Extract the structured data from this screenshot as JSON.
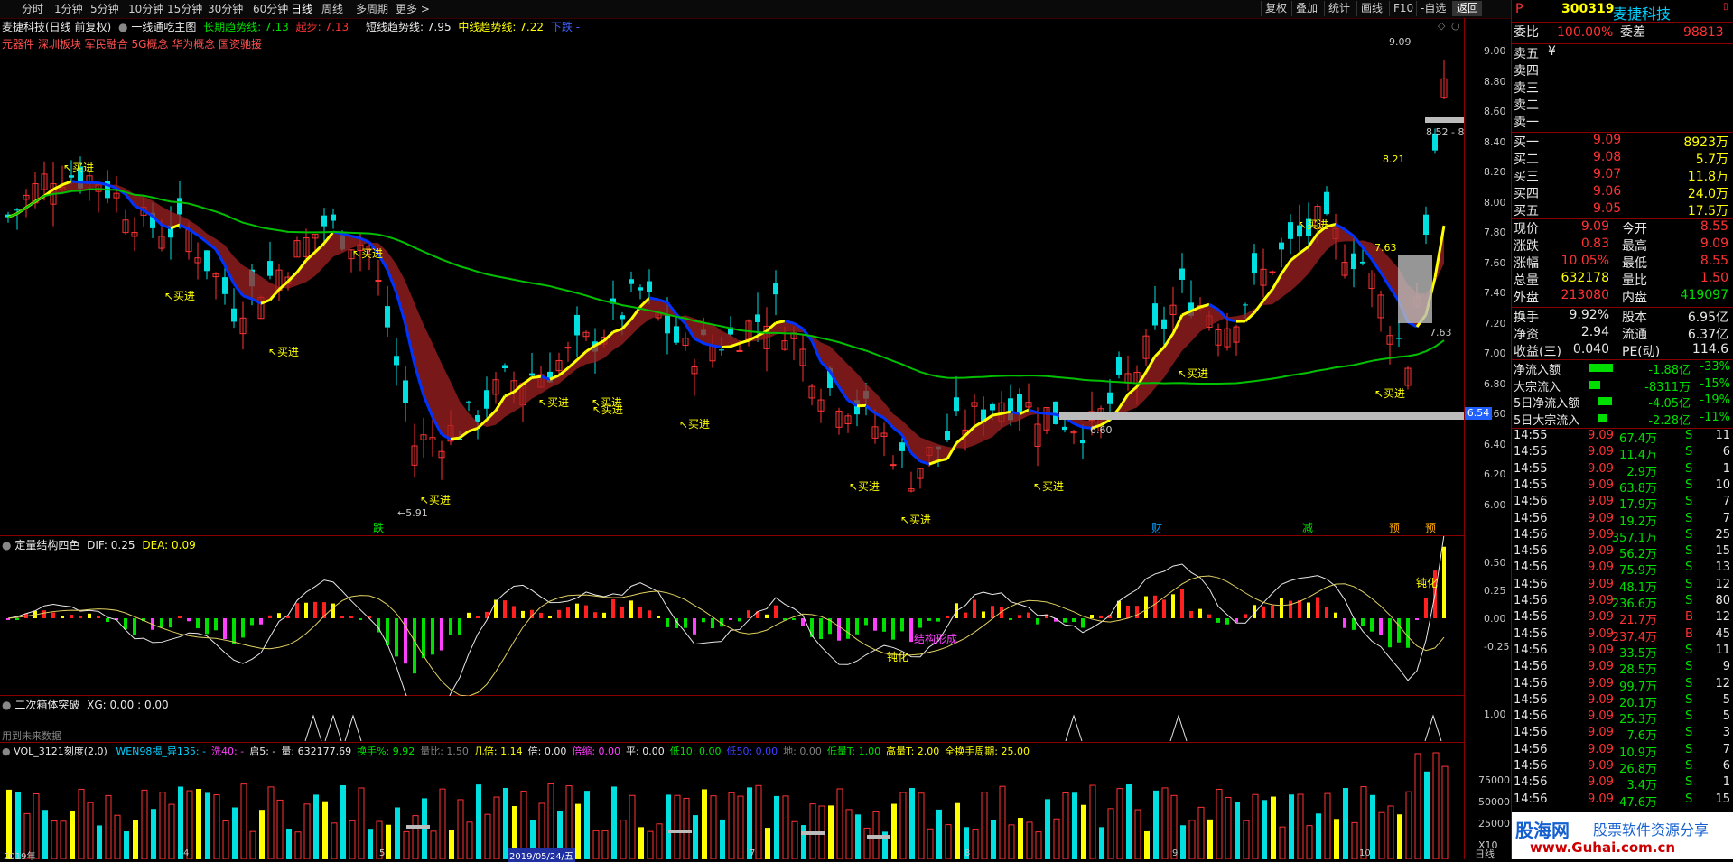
{
  "toolbar": {
    "left_items": [
      "分时",
      "1分钟",
      "5分钟",
      "10分钟",
      "15分钟",
      "30分钟",
      "60分钟",
      "日线",
      "周线",
      "多周期",
      "更多 >"
    ],
    "right_items": [
      "复权",
      "叠加",
      "统计",
      "画线",
      "F10",
      "-自选",
      "返回"
    ],
    "active": "日线"
  },
  "header": {
    "stock_name": "麦捷科技(日线 前复权)",
    "indicator": "一线通吃主图",
    "long_trend_label": "长期趋势线:",
    "long_trend_value": "7.13",
    "start_label": "起步:",
    "start_value": "7.13",
    "short_trend_label": "短线趋势线:",
    "short_trend_value": "7.95",
    "mid_trend_label": "中线趋势线:",
    "mid_trend_value": "7.22",
    "state": "下跌",
    "state_suffix": "-",
    "concepts": "元器件 深圳板块 军民融合 5G概念 华为概念 国资驰援"
  },
  "main_axis": [
    "9.00",
    "8.80",
    "8.60",
    "8.40",
    "8.20",
    "8.00",
    "7.80",
    "7.60",
    "7.40",
    "7.20",
    "7.00",
    "6.80",
    "6.60",
    "6.40",
    "6.20",
    "6.00"
  ],
  "price_annotations": {
    "high": "9.09",
    "range": "8.52 - 8.",
    "p821": "8.21",
    "p763a": "7.63",
    "p763b": "7.63",
    "p660": "6.60",
    "low": "5.91",
    "current_tag": "6.54"
  },
  "signals": {
    "buy": "买进",
    "buy_list": [
      "买进",
      "买进",
      "买进",
      "买进",
      "买进",
      "买进",
      "买进",
      "买进",
      "买进",
      "买进",
      "买进",
      "买进",
      "买进",
      "买进",
      "买进"
    ],
    "bottom_tags": [
      {
        "text": "跌",
        "color": "#00e000"
      },
      {
        "text": "财",
        "color": "#00a0ff"
      },
      {
        "text": "减",
        "color": "#00e000"
      },
      {
        "text": "预",
        "color": "#ffaa00"
      },
      {
        "text": "预",
        "color": "#ffaa00"
      }
    ]
  },
  "macd_pane": {
    "title": "定量结构四色",
    "dif_label": "DIF:",
    "dif": "0.25",
    "dea_label": "DEA:",
    "dea": "0.09",
    "axis": [
      "0.50",
      "0.25",
      "0.00",
      "-0.25"
    ],
    "notes": [
      "钝化",
      "结构形成",
      "钝化"
    ]
  },
  "box_pane": {
    "title": "二次箱体突破",
    "xg_label": "XG:",
    "xg": "0.00",
    "xg2": ": 0.00",
    "axis": [
      "1.00"
    ],
    "footer": "用到未来数据"
  },
  "vol_pane": {
    "title": "VOL_3121刻度(2,0)",
    "items": [
      {
        "t": "WEN98揭_异135: -",
        "c": "#00d0ff"
      },
      {
        "t": "洗40: -",
        "c": "#ff40ff"
      },
      {
        "t": "启5: -",
        "c": "#e8e8e8"
      },
      {
        "t": "量: 632177.69",
        "c": "#e8e8e8"
      },
      {
        "t": "换手%: 9.92",
        "c": "#00e000"
      },
      {
        "t": "量比: 1.50",
        "c": "#808080"
      },
      {
        "t": "几倍: 1.14",
        "c": "#ffff00"
      },
      {
        "t": "倍: 0.00",
        "c": "#e8e8e8"
      },
      {
        "t": "倍缩: 0.00",
        "c": "#ff40ff"
      },
      {
        "t": "平: 0.00",
        "c": "#e8e8e8"
      },
      {
        "t": "低10: 0.00",
        "c": "#00e000"
      },
      {
        "t": "低50: 0.00",
        "c": "#4040ff"
      },
      {
        "t": "地: 0.00",
        "c": "#808080"
      },
      {
        "t": "低量T: 1.00",
        "c": "#00e000"
      },
      {
        "t": "高量T: 2.00",
        "c": "#ffff00"
      },
      {
        "t": "全换手周期: 25.00",
        "c": "#ffff00"
      }
    ],
    "axis": [
      "75000",
      "50000",
      "25000",
      "X10"
    ],
    "dates": [
      "2019年",
      "4",
      "5",
      "2019/05/24/五",
      "7",
      "8",
      "9",
      "10"
    ],
    "period_tab": "日线"
  },
  "quote": {
    "code": "300319",
    "name": "麦捷科技",
    "weibi_label": "委比",
    "weibi": "100.00%",
    "weicha_label": "委差",
    "weicha": "98813",
    "asks": [
      {
        "label": "卖五",
        "price": "¥",
        "vol": ""
      },
      {
        "label": "卖四",
        "price": "",
        "vol": ""
      },
      {
        "label": "卖三",
        "price": "",
        "vol": ""
      },
      {
        "label": "卖二",
        "price": "",
        "vol": ""
      },
      {
        "label": "卖一",
        "price": "",
        "vol": ""
      }
    ],
    "bids": [
      {
        "label": "买一",
        "price": "9.09",
        "vol": "8923万"
      },
      {
        "label": "买二",
        "price": "9.08",
        "vol": "5.7万"
      },
      {
        "label": "买三",
        "price": "9.07",
        "vol": "11.8万"
      },
      {
        "label": "买四",
        "price": "9.06",
        "vol": "24.0万"
      },
      {
        "label": "买五",
        "price": "9.05",
        "vol": "17.5万"
      }
    ],
    "stats": [
      {
        "l1": "现价",
        "v1": "9.09",
        "l2": "今开",
        "v2": "8.55"
      },
      {
        "l1": "涨跌",
        "v1": "0.83",
        "l2": "最高",
        "v2": "9.09"
      },
      {
        "l1": "涨幅",
        "v1": "10.05%",
        "l2": "最低",
        "v2": "8.55"
      },
      {
        "l1": "总量",
        "v1": "632178",
        "l2": "量比",
        "v2": "1.50"
      },
      {
        "l1": "外盘",
        "v1": "213080",
        "l2": "内盘",
        "v2": "419097"
      }
    ],
    "stats2": [
      {
        "l1": "换手",
        "v1": "9.92%",
        "l2": "股本",
        "v2": "6.95亿"
      },
      {
        "l1": "净资",
        "v1": "2.94",
        "l2": "流通",
        "v2": "6.37亿"
      },
      {
        "l1": "收益(三)",
        "v1": "0.040",
        "l2": "PE(动)",
        "v2": "114.6"
      }
    ],
    "flows": [
      {
        "label": "净流入额",
        "value": "-1.88亿",
        "pct": "-33%",
        "bar": 0.33
      },
      {
        "label": "大宗流入",
        "value": "-8311万",
        "pct": "-15%",
        "bar": 0.15
      },
      {
        "label": "5日净流入额",
        "value": "-4.05亿",
        "pct": "-19%",
        "bar": 0.19
      },
      {
        "label": "5日大宗流入",
        "value": "-2.28亿",
        "pct": "-11%",
        "bar": 0.11
      }
    ],
    "ticks": [
      {
        "t": "14:55",
        "p": "9.09",
        "v": "67.4万",
        "s": "S",
        "n": "11"
      },
      {
        "t": "14:55",
        "p": "9.09",
        "v": "11.4万",
        "s": "S",
        "n": "6"
      },
      {
        "t": "14:55",
        "p": "9.09",
        "v": "2.9万",
        "s": "S",
        "n": "1"
      },
      {
        "t": "14:55",
        "p": "9.09",
        "v": "63.8万",
        "s": "S",
        "n": "10"
      },
      {
        "t": "14:56",
        "p": "9.09",
        "v": "17.9万",
        "s": "S",
        "n": "7"
      },
      {
        "t": "14:56",
        "p": "9.09",
        "v": "19.2万",
        "s": "S",
        "n": "7"
      },
      {
        "t": "14:56",
        "p": "9.09",
        "v": "357.1万",
        "s": "S",
        "n": "25"
      },
      {
        "t": "14:56",
        "p": "9.09",
        "v": "56.2万",
        "s": "S",
        "n": "15"
      },
      {
        "t": "14:56",
        "p": "9.09",
        "v": "75.9万",
        "s": "S",
        "n": "13"
      },
      {
        "t": "14:56",
        "p": "9.09",
        "v": "48.1万",
        "s": "S",
        "n": "12"
      },
      {
        "t": "14:56",
        "p": "9.09",
        "v": "236.6万",
        "s": "S",
        "n": "80"
      },
      {
        "t": "14:56",
        "p": "9.09",
        "v": "21.7万",
        "s": "B",
        "n": "12"
      },
      {
        "t": "14:56",
        "p": "9.09",
        "v": "237.4万",
        "s": "B",
        "n": "45"
      },
      {
        "t": "14:56",
        "p": "9.09",
        "v": "33.5万",
        "s": "S",
        "n": "11"
      },
      {
        "t": "14:56",
        "p": "9.09",
        "v": "28.5万",
        "s": "S",
        "n": "9"
      },
      {
        "t": "14:56",
        "p": "9.09",
        "v": "99.7万",
        "s": "S",
        "n": "12"
      },
      {
        "t": "14:56",
        "p": "9.09",
        "v": "20.1万",
        "s": "S",
        "n": "5"
      },
      {
        "t": "14:56",
        "p": "9.09",
        "v": "25.3万",
        "s": "S",
        "n": "5"
      },
      {
        "t": "14:56",
        "p": "9.09",
        "v": "7.6万",
        "s": "S",
        "n": "3"
      },
      {
        "t": "14:56",
        "p": "9.09",
        "v": "10.9万",
        "s": "S",
        "n": "7"
      },
      {
        "t": "14:56",
        "p": "9.09",
        "v": "26.8万",
        "s": "S",
        "n": "6"
      },
      {
        "t": "14:56",
        "p": "9.09",
        "v": "3.4万",
        "s": "S",
        "n": "1"
      },
      {
        "t": "14:56",
        "p": "9.09",
        "v": "47.6万",
        "s": "S",
        "n": "15"
      }
    ]
  },
  "watermark": {
    "logo": "股海网",
    "slogan": "股票软件资源分享",
    "url": "www.Guhai.com.cn"
  },
  "colors": {
    "up": "#ff3333",
    "down": "#00e0e0",
    "ma_long": "#00c000",
    "trend_up": "#ffff00",
    "trend_down": "#0033ff",
    "band": "#a02020"
  }
}
